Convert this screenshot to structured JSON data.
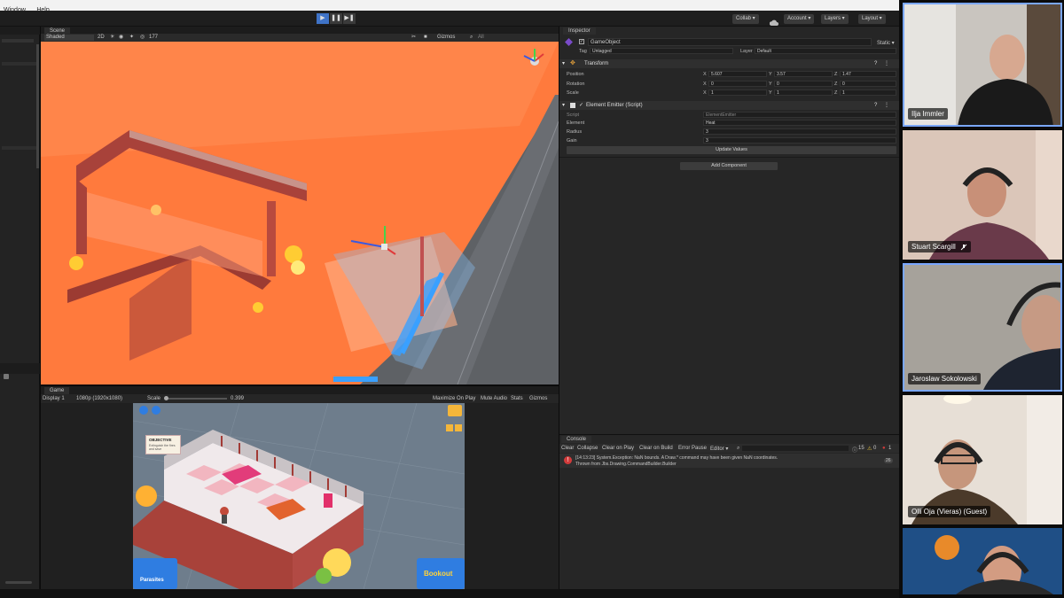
{
  "menubar": {
    "items": [
      "Window",
      "Help"
    ]
  },
  "toolbar": {
    "play": "▶",
    "pause": "❚❚",
    "step": "▶❚",
    "collab": "Collab ▾",
    "account": "Account ▾",
    "layers": "Layers ▾",
    "layout": "Layout ▾"
  },
  "scene": {
    "tab": "Scene",
    "shading": "Shaded",
    "mode2d": "2D",
    "count": "177",
    "gizmos": "Gizmos",
    "all": "All"
  },
  "game": {
    "tab": "Game",
    "display": "Display 1",
    "resolution": "1080p (1920x1080)",
    "scale_label": "Scale",
    "scale_value": "0.399",
    "maximize": "Maximize On Play",
    "mute": "Mute Audio",
    "stats": "Stats",
    "gizmos": "Gizmos",
    "objective_title": "OBJECTIVE",
    "objective_text": "Extinguish the fires and save",
    "bottom_left": "Parasites",
    "bottom_right": "Bookout"
  },
  "inspector": {
    "tab": "Inspector",
    "object_name": "GameObject",
    "static_label": "Static ▾",
    "tag_label": "Tag",
    "tag_value": "Untagged",
    "layer_label": "Layer",
    "layer_value": "Default",
    "transform": {
      "title": "Transform",
      "position_label": "Position",
      "rotation_label": "Rotation",
      "scale_label": "Scale",
      "position": {
        "x": "5.607",
        "y": "3.57",
        "z": "1.47"
      },
      "rotation": {
        "x": "0",
        "y": "0",
        "z": "0"
      },
      "scale": {
        "x": "1",
        "y": "1",
        "z": "1"
      }
    },
    "emitter": {
      "title": "Element Emitter (Script)",
      "script_label": "Script",
      "script_value": "ElementEmitter",
      "element_label": "Element",
      "element_value": "Heat",
      "radius_label": "Radius",
      "radius_value": "3",
      "gain_label": "Gain",
      "gain_value": "3",
      "update_button": "Update Values"
    },
    "add_component": "Add Component"
  },
  "console": {
    "tab": "Console",
    "buttons": [
      "Clear",
      "Collapse",
      "Clear on Play",
      "Clear on Build",
      "Error Pause",
      "Editor ▾"
    ],
    "counts": {
      "logs": "15",
      "warnings": "0",
      "errors": "1"
    },
    "entry_line1": "[14:13:23] System.Exception: NaN bounds. A Draw.* command may have been given NaN coordinates.",
    "entry_line2": "Thrown from Jbs.Drawing.CommandBuilder.Builder",
    "entry_count": "26"
  },
  "participants": [
    {
      "name": "Ilja Immler",
      "muted": false,
      "selected": true
    },
    {
      "name": "Stuart Scargill",
      "muted": true,
      "selected": false
    },
    {
      "name": "Jaroslaw Sokolowski",
      "muted": false,
      "selected": true
    },
    {
      "name": "Olli Oja (Vieras) (Guest)",
      "muted": false,
      "selected": false
    },
    {
      "name": "",
      "muted": false,
      "selected": false
    }
  ],
  "colors": {
    "heat_overlay": "#ff7a3d",
    "unity_dark": "#262626",
    "selection_outline": "#7aa7ff",
    "error_red": "#d23b3b"
  }
}
